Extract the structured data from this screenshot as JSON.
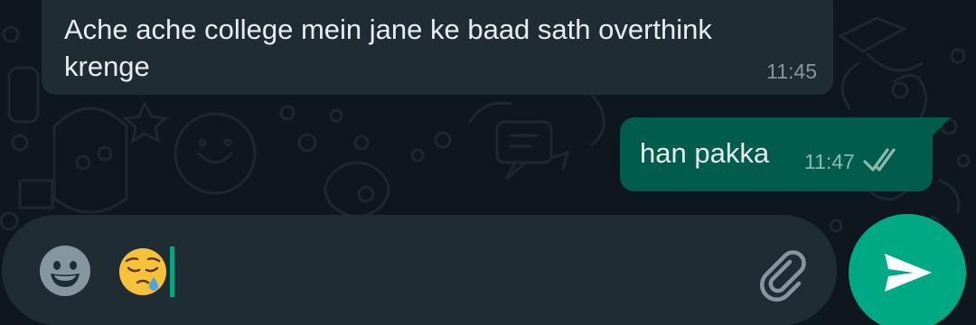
{
  "conversation": {
    "messages": [
      {
        "direction": "incoming",
        "text": "Ache ache college mein jane ke baad sath overthink krenge",
        "time": "11:45"
      },
      {
        "direction": "outgoing",
        "text": "han pakka",
        "time": "11:47",
        "status": "delivered",
        "status_icon": "double-check-icon"
      }
    ]
  },
  "composer": {
    "typed_text": "😪",
    "emoji_button_icon": "smiley-icon",
    "attach_button_icon": "paperclip-icon",
    "send_button_icon": "send-icon"
  },
  "colors": {
    "background": "#0e171d",
    "incoming_bubble": "#202c33",
    "outgoing_bubble": "#005c4b",
    "input_bar": "#1f2c34",
    "accent": "#00a884",
    "text": "#e9edef",
    "timestamp": "#8696a0"
  }
}
